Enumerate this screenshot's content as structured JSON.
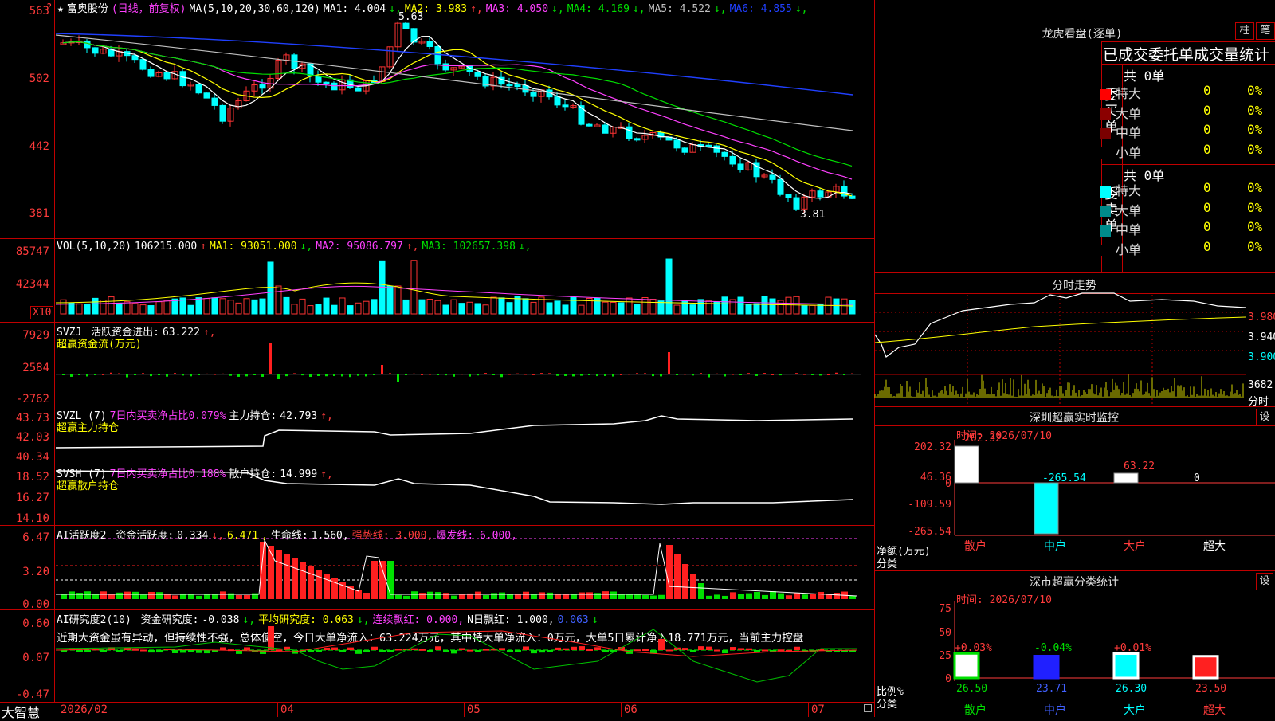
{
  "stock": {
    "name": "富奥股份",
    "mode": "(日线，前复权)",
    "ma_header": "MA(5,10,20,30,60,120)",
    "ma": [
      {
        "label": "MA1:",
        "value": "4.004",
        "arrow": "↓",
        "color": "#ffffff"
      },
      {
        "label": "MA2:",
        "value": "3.983",
        "arrow": "↑",
        "color": "#ffff00"
      },
      {
        "label": "MA3:",
        "value": "4.050",
        "arrow": "↓",
        "color": "#ff40ff"
      },
      {
        "label": "MA4:",
        "value": "4.169",
        "arrow": "↓",
        "color": "#00e000"
      },
      {
        "label": "MA5:",
        "value": "4.522",
        "arrow": "↓",
        "color": "#c0c0c0"
      },
      {
        "label": "MA6:",
        "value": "4.855",
        "arrow": "↓",
        "color": "#2040ff"
      }
    ],
    "price_axis": [
      "563",
      "502",
      "442",
      "381"
    ],
    "high_mark": "5.63",
    "low_mark": "3.81"
  },
  "volume": {
    "header": "VOL(5,10,20)",
    "value": "106215.000",
    "arrow": "↑",
    "ma": [
      {
        "label": "MA1:",
        "value": "93051.000",
        "arrow": "↓",
        "color": "#ffff00"
      },
      {
        "label": "MA2:",
        "value": "95086.797",
        "arrow": "↑",
        "color": "#ff40ff"
      },
      {
        "label": "MA3:",
        "value": "102657.398",
        "arrow": "↓",
        "color": "#00e000"
      }
    ],
    "axis": [
      "85747",
      "42344"
    ],
    "unit": "X10"
  },
  "svzj": {
    "header": "SVZJ",
    "label": "活跃资金进出:",
    "value": "63.222",
    "arrow": "↑,",
    "sub": "超赢资金流(万元)",
    "axis": [
      "7929",
      "2584",
      "-2762"
    ]
  },
  "svzl": {
    "header": "SVZL (7)",
    "pct_label": "7日内买卖净占比0.079%",
    "label": "主力持仓:",
    "value": "42.793",
    "arrow": "↑,",
    "sub": "超赢主力持仓",
    "axis": [
      "43.73",
      "42.03",
      "40.34"
    ]
  },
  "svsh": {
    "header": "SVSH (7)",
    "pct_label": "7日内买卖净占比0.188%",
    "label": "散户持仓:",
    "value": "14.999",
    "arrow": "↑,",
    "sub": "超赢散户持仓",
    "axis": [
      "18.52",
      "16.27",
      "14.10"
    ]
  },
  "ai_active": {
    "header": "AI活跃度2",
    "label": "资金活跃度:",
    "value": "0.334",
    "value2": "6.471",
    "life_label": "生命线:",
    "life_value": "1.560,",
    "strong": "强势线: 3.000,",
    "burst": "爆发线: 6.000,",
    "axis": [
      "6.47",
      "3.20",
      "0.00"
    ]
  },
  "ai_research": {
    "header": "AI研究度2(10)",
    "label": "资金研究度:",
    "value": "-0.038",
    "avg": "平均研究度: 0.063",
    "red": "连续飘红: 0.000,",
    "nday": "N日飘红: 1.000,",
    "last": "0.063",
    "comment": "近期大资金虽有异动，但持续性不强，总体偏空，今日大单净流入：63.224万元，其中特大单净流入：0万元，大单5日累计净入18.771万元，当前主力控盘",
    "axis": [
      "0.60",
      "0.07",
      "-0.47"
    ]
  },
  "dates": {
    "brand": "大智慧",
    "labels": [
      "2026/02",
      "04",
      "05",
      "06",
      "07"
    ]
  },
  "side": {
    "lhb_title": "龙虎看盘(逐单)",
    "btn_zhu": "柱",
    "btn_bi": "笔",
    "stat_title": "已成交委托单成交量统计",
    "buy_label": "委买单",
    "sell_label": "委卖单",
    "buy_total": "共 0单",
    "sell_total": "共 0单",
    "rows": [
      {
        "name": "特大",
        "n": "0",
        "p": "0%"
      },
      {
        "name": "大单",
        "n": "0",
        "p": "0%"
      },
      {
        "name": "中单",
        "n": "0",
        "p": "0%"
      },
      {
        "name": "小单",
        "n": "0",
        "p": "0%"
      }
    ],
    "buy_colors": [
      "#ff0000",
      "#8b0000",
      "#7a0000",
      "#000000"
    ],
    "sell_colors": [
      "#00ffff",
      "#008b8b",
      "#008b8b",
      "#000000"
    ],
    "intraday_title": "分时走势",
    "intraday_axis": [
      "3.980",
      "3.940",
      "3.900"
    ],
    "intraday_vol": "3682",
    "intraday_fs": "分时",
    "monitor_title": "深圳超赢实时监控",
    "monitor_set": "设",
    "monitor_date": "时间: 2026/07/10",
    "monitor_axis": [
      "202.32",
      "46.36",
      "0",
      "-109.59",
      "-265.54"
    ],
    "monitor_values": [
      "202.32",
      "-265.54",
      "63.22",
      "0"
    ],
    "monitor_xlabel1": "净额(万元)",
    "monitor_xlabel2": "分类",
    "cats": [
      "散户",
      "中户",
      "大户",
      "超大"
    ],
    "cls_title": "深市超赢分类统计",
    "cls_set": "设",
    "cls_date": "时间: 2026/07/10",
    "cls_axis": [
      "75",
      "50",
      "25",
      "0"
    ],
    "cls_pct": [
      "+0.03%",
      "-0.04%",
      "+0.01%"
    ],
    "cls_values": [
      "26.50",
      "23.71",
      "26.30",
      "23.50"
    ],
    "cls_xlabel1": "比例%",
    "cls_xlabel2": "分类"
  }
}
